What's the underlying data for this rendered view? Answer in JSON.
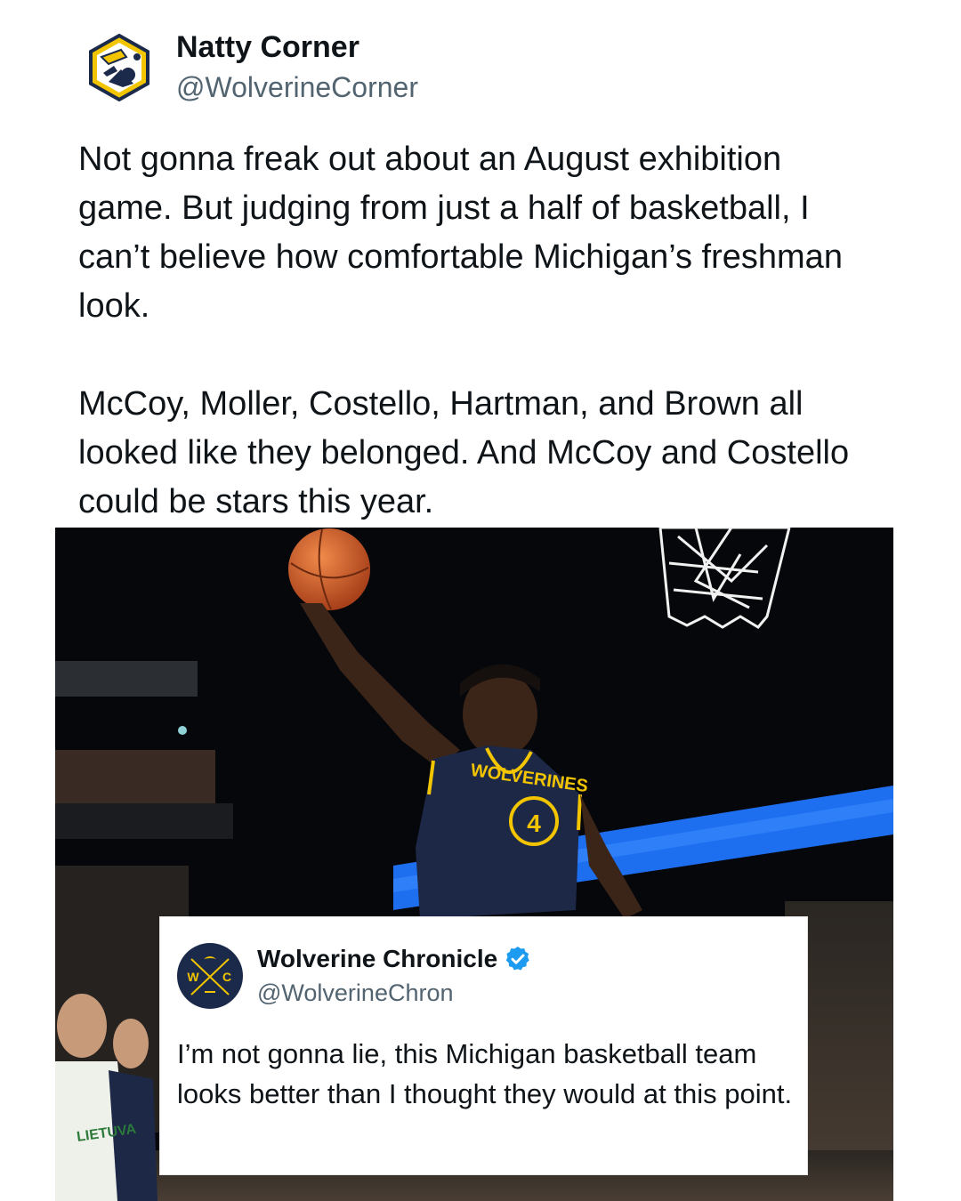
{
  "tweet": {
    "display_name": "Natty Corner",
    "handle": "@WolverineCorner",
    "avatar_icon": "natty-corner-logo-icon",
    "text": "Not gonna freak out about an August exhibition game. But judging from just a half of basketball, I can’t believe how comfortable Michigan’s freshman look.\n\nMcCoy, Moller, Costello, Hartman, and Brown all looked like they belonged. And McCoy and Costello could be stars this year."
  },
  "photo": {
    "jersey_text": "WOLVERINES",
    "jersey_number": "4",
    "opponent_jersey_text": "LIETUVA",
    "colors": {
      "jersey_navy": "#1c2846",
      "jersey_gold": "#f2c500",
      "arena_blue": "#1d6ff0",
      "ball_orange": "#d9642a"
    }
  },
  "quote": {
    "display_name": "Wolverine Chronicle",
    "handle": "@WolverineChron",
    "verified_icon": "verified-badge-icon",
    "avatar_icon": "wolverine-chronicle-logo-icon",
    "avatar_letters": {
      "left": "W",
      "right": "C"
    },
    "text": "I’m not gonna lie, this Michigan basketball team looks better than I thought they would at this point."
  },
  "colors": {
    "text_primary": "#0f1419",
    "text_secondary": "#536471",
    "verified_blue": "#1d9bf0",
    "logo_gold": "#f2c500",
    "logo_navy": "#1b2a4a"
  }
}
